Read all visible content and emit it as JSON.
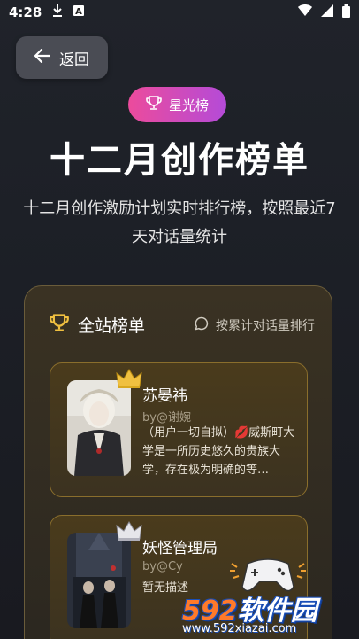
{
  "status_bar": {
    "time": "4:28",
    "icons": [
      "download-icon",
      "a-notification-icon",
      "wifi-icon",
      "signal-icon",
      "battery-icon"
    ]
  },
  "back_button": {
    "label": "返回",
    "icon": "arrow-left-icon"
  },
  "badge": {
    "label": "星光榜",
    "icon": "trophy-icon"
  },
  "header": {
    "title": "十二月创作榜单",
    "subtitle": "十二月创作激励计划实时排行榜，按照最近7天对话量统计"
  },
  "ranking": {
    "title": "全站榜单",
    "sort_label": "按累计对话量排行",
    "items": [
      {
        "name": "苏晏祎",
        "author": "by@谢婉",
        "description": "（用户一切自拟）💋威斯町大学是一所历史悠久的贵族大学，存在极为明确的等…",
        "crown": "gold"
      },
      {
        "name": "妖怪管理局",
        "author": "by@Cy",
        "description": "暂无描述",
        "crown": "silver"
      }
    ]
  },
  "watermark": {
    "logo_num": "592",
    "logo_text": "软件园",
    "url": "www.592xiazai.com"
  },
  "colors": {
    "accent_pink": "#ec4b9c",
    "accent_purple": "#b44bd8",
    "gold": "#f0c040"
  }
}
